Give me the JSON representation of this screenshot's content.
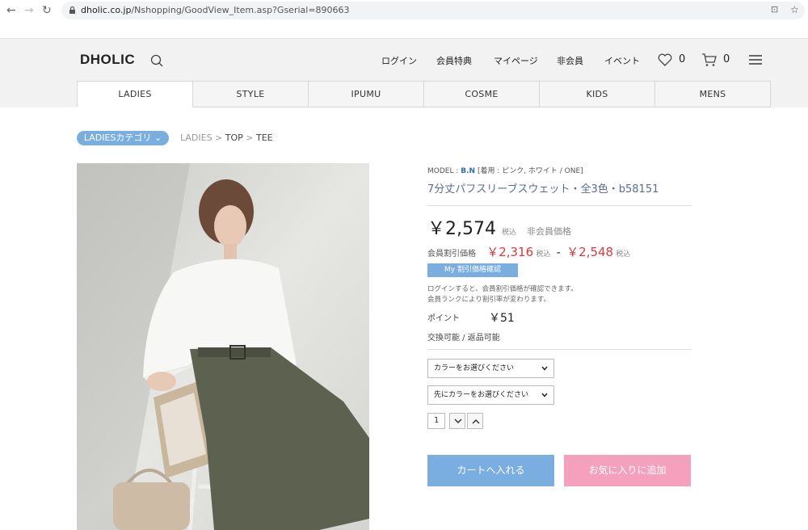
{
  "browser": {
    "url_host": "dholic.co.jp",
    "url_path": "/Nshopping/GoodView_Item.asp?Gserial=890663"
  },
  "header": {
    "logo": "DHOLIC",
    "nav": [
      "ログイン",
      "会員特典",
      "マイページ",
      "非会員",
      "イベント"
    ],
    "wishlist_count": "0",
    "cart_count": "0"
  },
  "tabs": [
    {
      "label": "LADIES",
      "active": true
    },
    {
      "label": "STYLE",
      "active": false
    },
    {
      "label": "IPUMU",
      "active": false
    },
    {
      "label": "COSME",
      "active": false
    },
    {
      "label": "KIDS",
      "active": false
    },
    {
      "label": "MENS",
      "active": false
    }
  ],
  "breadcrumb": {
    "category_button": "LADIESカテゴリ",
    "items": [
      "LADIES",
      "TOP",
      "TEE"
    ]
  },
  "product": {
    "model_prefix": "MODEL :",
    "model_name": "B.N",
    "model_note": "[着用 : ピンク, ホワイト / ONE]",
    "title": "7分丈パフスリーブスウェット・全3色・b58151",
    "price": "￥2,574",
    "tax_label": "税込",
    "non_member_label": "非会員価格",
    "member_label": "会員割引価格",
    "member_price_low": "￥2,316",
    "member_price_high": "￥2,548",
    "dash": "-",
    "my_discount_button": "My 割引価格確認",
    "note_line1": "ログインすると、会員割引価格が確認できます。",
    "note_line2": "会員ランクにより割引率が変わります。",
    "point_label": "ポイント",
    "point_value": "￥51",
    "return_policy": "交換可能 / 返品可能",
    "color_select": "カラーをお選びください",
    "size_select": "先にカラーをお選びください",
    "quantity": "1",
    "add_to_cart": "カートへ入れる",
    "add_to_favorites": "お気に入りに追加"
  },
  "colors": {
    "accent_blue": "#7aaee0",
    "cart_button": "#7aaee0",
    "favorite_button": "#f5a0bc",
    "member_price": "#d63b3b"
  }
}
